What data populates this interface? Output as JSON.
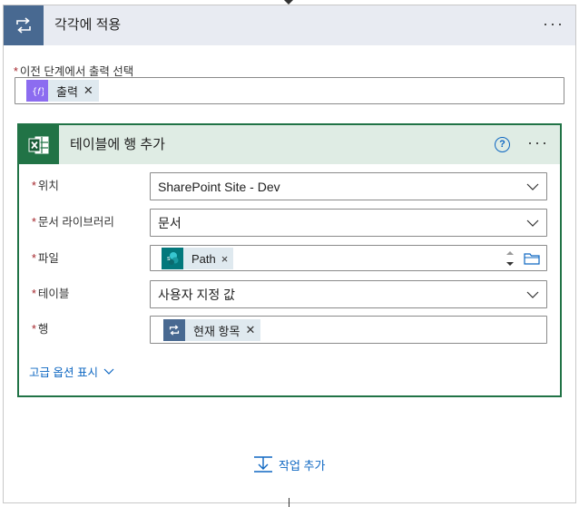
{
  "apply_each": {
    "title": "각각에 적용",
    "more_label": "···",
    "output_select_label": "이전 단계에서 출력 선택",
    "output_token": "출력",
    "remove_glyph": "✕"
  },
  "add_row": {
    "title": "테이블에 행 추가",
    "help_glyph": "?",
    "more_label": "···",
    "location_label": "위치",
    "location_value": "SharePoint Site - Dev",
    "library_label": "문서 라이브러리",
    "library_value": "문서",
    "file_label": "파일",
    "file_token": "Path",
    "file_token_remove": "×",
    "table_label": "테이블",
    "table_value": "사용자 지정 값",
    "row_label": "행",
    "row_token": "현재 항목",
    "row_token_remove": "✕",
    "advanced_label": "고급 옵션 표시"
  },
  "footer": {
    "add_action_label": "작업 추가"
  },
  "required_marker": "*",
  "colors": {
    "loop_header_icon": "#486991",
    "excel_green": "#217346",
    "sharepoint_teal": "#03787c",
    "expression_purple": "#8c6cf0",
    "link_blue": "#0e67c2",
    "required_red": "#a4262c"
  }
}
